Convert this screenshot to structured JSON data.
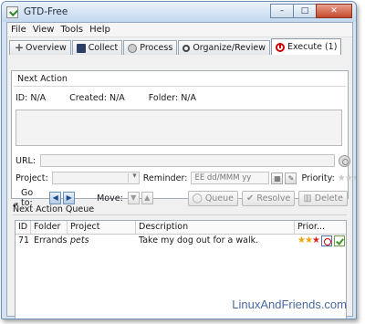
{
  "window": {
    "title": "GTD-Free",
    "min_label": "–",
    "max_label": "□",
    "close_label": "✕"
  },
  "menu": [
    "File",
    "View",
    "Tools",
    "Help"
  ],
  "tabs": [
    {
      "label": "Overview",
      "icon": "plus-icon"
    },
    {
      "label": "Collect",
      "icon": "collect-icon"
    },
    {
      "label": "Process",
      "icon": "process-icon"
    },
    {
      "label": "Organize/Review",
      "icon": "search-icon"
    },
    {
      "label": "Execute (1)",
      "icon": "execute-icon",
      "active": true
    }
  ],
  "next_action": {
    "heading": "Next Action",
    "id_label": "ID: N/A",
    "created_label": "Created: N/A",
    "folder_label": "Folder: N/A",
    "url_label": "URL:",
    "project_label": "Project:",
    "reminder_label": "Reminder:",
    "reminder_placeholder": "EE dd/MMM yy",
    "priority_label": "Priority:",
    "goto_label": "Go to:",
    "move_label": "Move:",
    "queue_button": "Queue",
    "resolve_button": "Resolve",
    "delete_button": "Delete"
  },
  "queue": {
    "heading": "Next Action Queue",
    "columns": [
      "ID",
      "Folder",
      "Project",
      "Description",
      "Prior..."
    ],
    "rows": [
      {
        "id": "71",
        "folder": "Errands",
        "project": "pets",
        "description": "Take my dog out for a walk.",
        "priority": 3
      }
    ]
  },
  "watermark": "LinuxAndFriends.com"
}
